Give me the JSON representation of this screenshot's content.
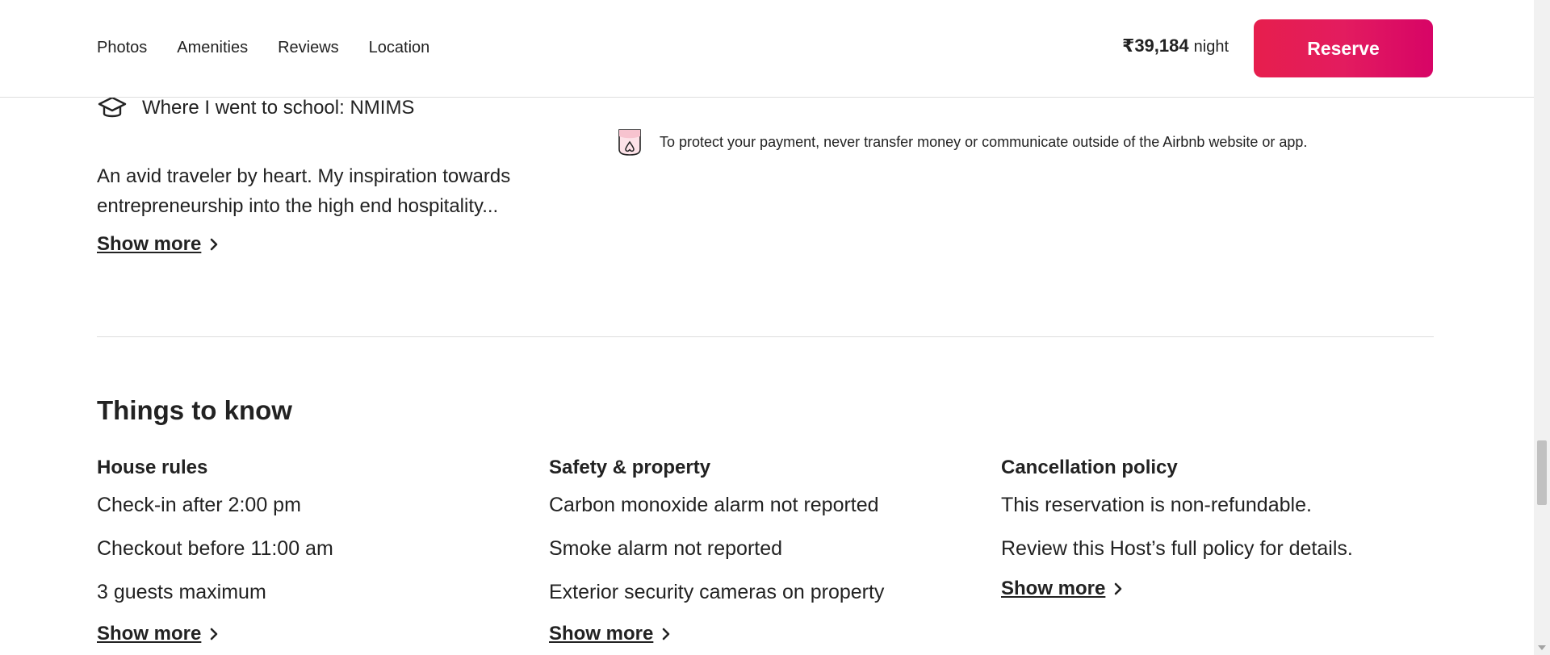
{
  "header": {
    "nav": [
      "Photos",
      "Amenities",
      "Reviews",
      "Location"
    ],
    "price": "₹39,184",
    "price_unit": "night",
    "reserve_label": "Reserve"
  },
  "host": {
    "school": "Where I went to school: NMIMS",
    "bio_line1": "An avid traveler by heart. My inspiration towards",
    "bio_line2": "entrepreneurship into the high end hospitality...",
    "show_more": "Show more"
  },
  "protection": {
    "text": "To protect your payment, never transfer money or communicate outside of the Airbnb website or app."
  },
  "things": {
    "title": "Things to know",
    "columns": [
      {
        "title": "House rules",
        "items": [
          "Check-in after 2:00 pm",
          "Checkout before 11:00 am",
          "3 guests maximum"
        ],
        "show_more": "Show more"
      },
      {
        "title": "Safety & property",
        "items": [
          "Carbon monoxide alarm not reported",
          "Smoke alarm not reported",
          "Exterior security cameras on property"
        ],
        "show_more": "Show more"
      },
      {
        "title": "Cancellation policy",
        "items": [
          "This reservation is non-refundable.",
          "Review this Host’s full policy for details."
        ],
        "show_more": "Show more"
      }
    ]
  },
  "colors": {
    "brand": "#e31c5f",
    "text": "#222222",
    "divider": "#dddddd"
  }
}
